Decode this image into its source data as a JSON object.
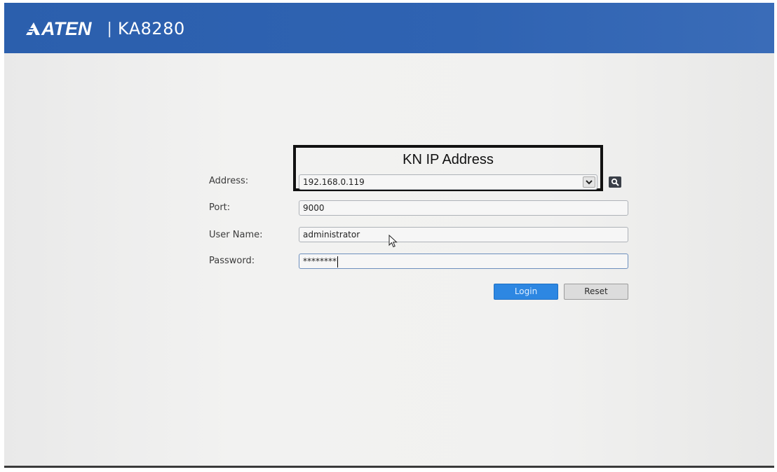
{
  "header": {
    "brand": "ATEN",
    "divider": "|",
    "model": "KA8280"
  },
  "annotation": {
    "callout_label": "KN IP Address"
  },
  "form": {
    "address": {
      "label": "Address:",
      "value": "192.168.0.119"
    },
    "port": {
      "label": "Port:",
      "value": "9000"
    },
    "username": {
      "label": "User Name:",
      "value": "administrator"
    },
    "password": {
      "label": "Password:",
      "value": "********"
    }
  },
  "buttons": {
    "login": "Login",
    "reset": "Reset"
  },
  "icons": {
    "dropdown": "chevron-down-icon",
    "search": "search-icon",
    "cursor": "mouse-pointer-icon"
  },
  "colors": {
    "header_blue": "#2f63b2",
    "login_blue": "#2d87e2"
  }
}
